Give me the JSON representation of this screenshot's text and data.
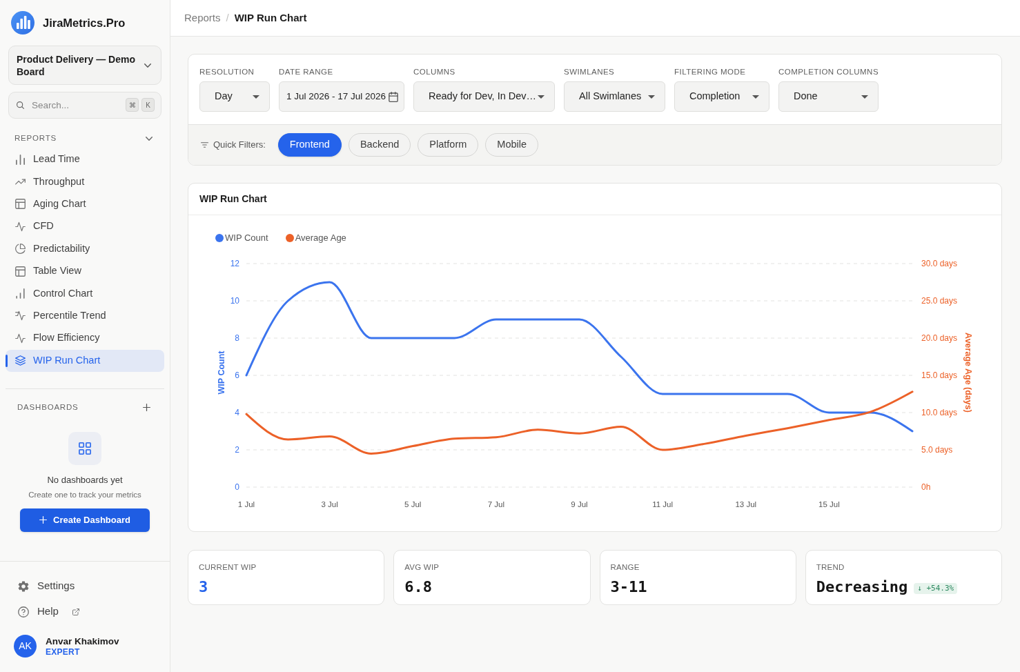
{
  "sidebar": {
    "brand": "JiraMetrics.Pro",
    "board_selector": "Product Delivery — Demo Board",
    "search": {
      "placeholder": "Search...",
      "shortcut": [
        "⌘",
        "K"
      ]
    },
    "reports": {
      "title": "REPORTS",
      "expanded": true,
      "items": [
        {
          "label": "Lead Time",
          "selected": false
        },
        {
          "label": "Throughput",
          "selected": false
        },
        {
          "label": "Aging Chart",
          "selected": false
        },
        {
          "label": "CFD",
          "selected": false
        },
        {
          "label": "Predictability",
          "selected": false
        },
        {
          "label": "Table View",
          "selected": false
        },
        {
          "label": "Control Chart",
          "selected": false
        },
        {
          "label": "Percentile Trend",
          "selected": false
        },
        {
          "label": "Flow Efficiency",
          "selected": false
        },
        {
          "label": "WIP Run Chart",
          "selected": true
        }
      ]
    },
    "dashboards": {
      "title": "DASHBOARDS",
      "empty_title": "No dashboards yet",
      "empty_text": "Create one to track your metrics",
      "create_button": "Create Dashboard"
    },
    "footer_links": [
      {
        "label": "Settings",
        "kind": "settings",
        "external": false
      },
      {
        "label": "Help",
        "kind": "help",
        "external": true
      }
    ],
    "user": {
      "initials": "AK",
      "name": "Anvar Khakimov",
      "role": "EXPERT"
    }
  },
  "breadcrumb": {
    "items": [
      "Reports",
      "WIP Run Chart"
    ],
    "separator": "/"
  },
  "filter_panel": {
    "filters": [
      {
        "label": "RESOLUTION",
        "value": "Day",
        "kind": "select"
      },
      {
        "label": "DATE RANGE",
        "value": "1 Jul 2026 - 17 Jul 2026",
        "kind": "date"
      },
      {
        "label": "COLUMNS",
        "value": "Ready for Dev, In Dev…",
        "kind": "select"
      },
      {
        "label": "SWIMLANES",
        "value": "All Swimlanes",
        "kind": "select"
      },
      {
        "label": "FILTERING MODE",
        "value": "Completion",
        "kind": "select"
      },
      {
        "label": "COMPLETION COLUMNS",
        "value": "Done",
        "kind": "select"
      }
    ],
    "quick_filters": {
      "label": "Quick Filters:",
      "options": [
        {
          "label": "Frontend",
          "selected": true
        },
        {
          "label": "Backend",
          "selected": false
        },
        {
          "label": "Platform",
          "selected": false
        },
        {
          "label": "Mobile",
          "selected": false
        }
      ]
    }
  },
  "chart": {
    "title": "WIP Run Chart",
    "chart_data": {
      "type": "line",
      "ylabel": "WIP Count",
      "y2label": "Average Age (days)",
      "categories": [
        "1 Jul",
        null,
        "3 Jul",
        null,
        "5 Jul",
        null,
        "7 Jul",
        null,
        "9 Jul",
        null,
        "11 Jul",
        null,
        "13 Jul",
        null,
        "15 Jul",
        null,
        null
      ],
      "ylim": [
        0,
        12
      ],
      "yticks": [
        0,
        2,
        4,
        6,
        8,
        10,
        12
      ],
      "y2lim": [
        0,
        30
      ],
      "y2ticks": [
        {
          "value": 0,
          "label": "0h"
        },
        {
          "value": 5,
          "label": "5.0 days"
        },
        {
          "value": 10,
          "label": "10.0 days"
        },
        {
          "value": 15,
          "label": "15.0 days"
        },
        {
          "value": 20,
          "label": "20.0 days"
        },
        {
          "value": 25,
          "label": "25.0 days"
        },
        {
          "value": 30,
          "label": "30.0 days"
        }
      ],
      "grid": true,
      "legend": "upper left",
      "series": [
        {
          "name": "WIP Count",
          "color": "#3b74ee",
          "values": [
            6,
            10,
            11,
            8,
            8,
            8,
            9,
            9,
            9,
            7,
            5,
            5,
            5,
            5,
            4,
            4,
            3
          ]
        },
        {
          "name": "Average Age",
          "color": "#ec6128",
          "axis": "y2",
          "values": [
            9.8,
            6.4,
            6.8,
            4.5,
            5.5,
            6.5,
            6.7,
            7.7,
            7.2,
            8.1,
            5.0,
            5.8,
            6.9,
            7.9,
            9.0,
            10.1,
            12.8
          ]
        }
      ]
    }
  },
  "stats": [
    {
      "label": "CURRENT WIP",
      "value": "3",
      "highlighted": true
    },
    {
      "label": "AVG WIP",
      "value": "6.8",
      "highlighted": false
    },
    {
      "label": "RANGE",
      "value": "3-11",
      "highlighted": false
    },
    {
      "label": "TREND",
      "value": "Decreasing",
      "highlighted": false,
      "badge": "↓ +54.3%"
    }
  ]
}
